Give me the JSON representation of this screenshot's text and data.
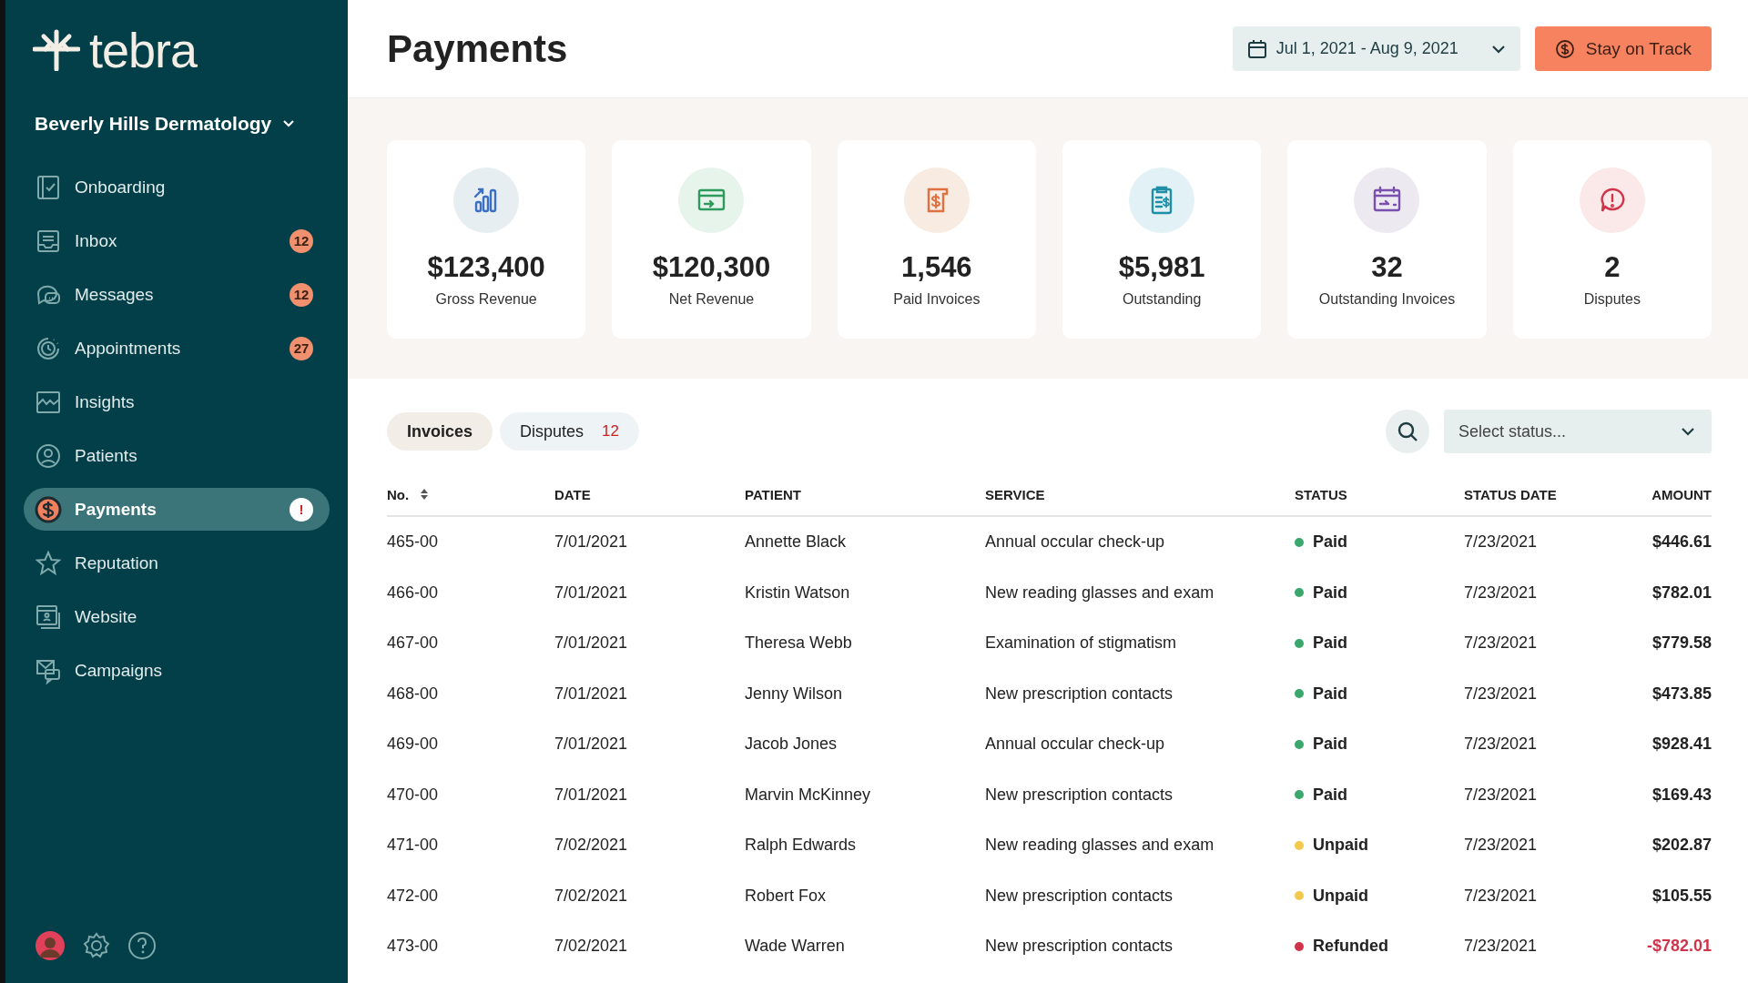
{
  "sidebar": {
    "logo": "tebra",
    "practice": "Beverly Hills Dermatology",
    "items": [
      {
        "label": "Onboarding",
        "selected": false
      },
      {
        "label": "Inbox",
        "badge": "12",
        "alert": false,
        "selected": false
      },
      {
        "label": "Messages",
        "badge": "12",
        "alert": false,
        "selected": false
      },
      {
        "label": "Appointments",
        "badge": "27",
        "alert": false,
        "selected": false
      },
      {
        "label": "Insights",
        "selected": false
      },
      {
        "label": "Patients",
        "selected": false
      },
      {
        "label": "Payments",
        "badge": "!",
        "alert": true,
        "selected": true
      },
      {
        "label": "Reputation",
        "selected": false
      },
      {
        "label": "Website",
        "selected": false
      },
      {
        "label": "Campaigns",
        "selected": false
      }
    ]
  },
  "header": {
    "title": "Payments",
    "date_range": "Jul 1, 2021 - Aug 9, 2021",
    "action": "Stay on Track"
  },
  "stats": [
    {
      "value": "$123,400",
      "label": "Gross Revenue"
    },
    {
      "value": "$120,300",
      "label": "Net Revenue"
    },
    {
      "value": "1,546",
      "label": "Paid Invoices"
    },
    {
      "value": "$5,981",
      "label": "Outstanding"
    },
    {
      "value": "32",
      "label": "Outstanding Invoices"
    },
    {
      "value": "2",
      "label": "Disputes"
    }
  ],
  "tabs": [
    {
      "label": "Invoices",
      "selected": true
    },
    {
      "label": "Disputes",
      "count": "12",
      "selected": false
    }
  ],
  "status_filter": {
    "placeholder": "Select status..."
  },
  "table": {
    "columns": [
      "No.",
      "DATE",
      "PATIENT",
      "SERVICE",
      "STATUS",
      "STATUS DATE",
      "AMOUNT"
    ],
    "rows": [
      {
        "no": "465-00",
        "date": "7/01/2021",
        "patient": "Annette Black",
        "service": "Annual occular check-up",
        "status": "Paid",
        "color": "#3aa76d",
        "status_date": "7/23/2021",
        "amount": "$446.61",
        "refunded": false
      },
      {
        "no": "466-00",
        "date": "7/01/2021",
        "patient": "Kristin Watson",
        "service": "New reading glasses and exam",
        "status": "Paid",
        "color": "#3aa76d",
        "status_date": "7/23/2021",
        "amount": "$782.01",
        "refunded": false
      },
      {
        "no": "467-00",
        "date": "7/01/2021",
        "patient": "Theresa Webb",
        "service": "Examination of stigmatism",
        "status": "Paid",
        "color": "#3aa76d",
        "status_date": "7/23/2021",
        "amount": "$779.58",
        "refunded": false
      },
      {
        "no": "468-00",
        "date": "7/01/2021",
        "patient": "Jenny Wilson",
        "service": "New prescription contacts",
        "status": "Paid",
        "color": "#3aa76d",
        "status_date": "7/23/2021",
        "amount": "$473.85",
        "refunded": false
      },
      {
        "no": "469-00",
        "date": "7/01/2021",
        "patient": "Jacob Jones",
        "service": "Annual occular check-up",
        "status": "Paid",
        "color": "#3aa76d",
        "status_date": "7/23/2021",
        "amount": "$928.41",
        "refunded": false
      },
      {
        "no": "470-00",
        "date": "7/01/2021",
        "patient": "Marvin McKinney",
        "service": "New prescription contacts",
        "status": "Paid",
        "color": "#3aa76d",
        "status_date": "7/23/2021",
        "amount": "$169.43",
        "refunded": false
      },
      {
        "no": "471-00",
        "date": "7/02/2021",
        "patient": "Ralph Edwards",
        "service": "New reading glasses and exam",
        "status": "Unpaid",
        "color": "#f2c94c",
        "status_date": "7/23/2021",
        "amount": "$202.87",
        "refunded": false
      },
      {
        "no": "472-00",
        "date": "7/02/2021",
        "patient": "Robert Fox",
        "service": "New prescription contacts",
        "status": "Unpaid",
        "color": "#f2c94c",
        "status_date": "7/23/2021",
        "amount": "$105.55",
        "refunded": false
      },
      {
        "no": "473-00",
        "date": "7/02/2021",
        "patient": "Wade Warren",
        "service": "New prescription contacts",
        "status": "Refunded",
        "color": "#d0344a",
        "status_date": "7/23/2021",
        "amount": "-$782.01",
        "refunded": true
      }
    ]
  }
}
